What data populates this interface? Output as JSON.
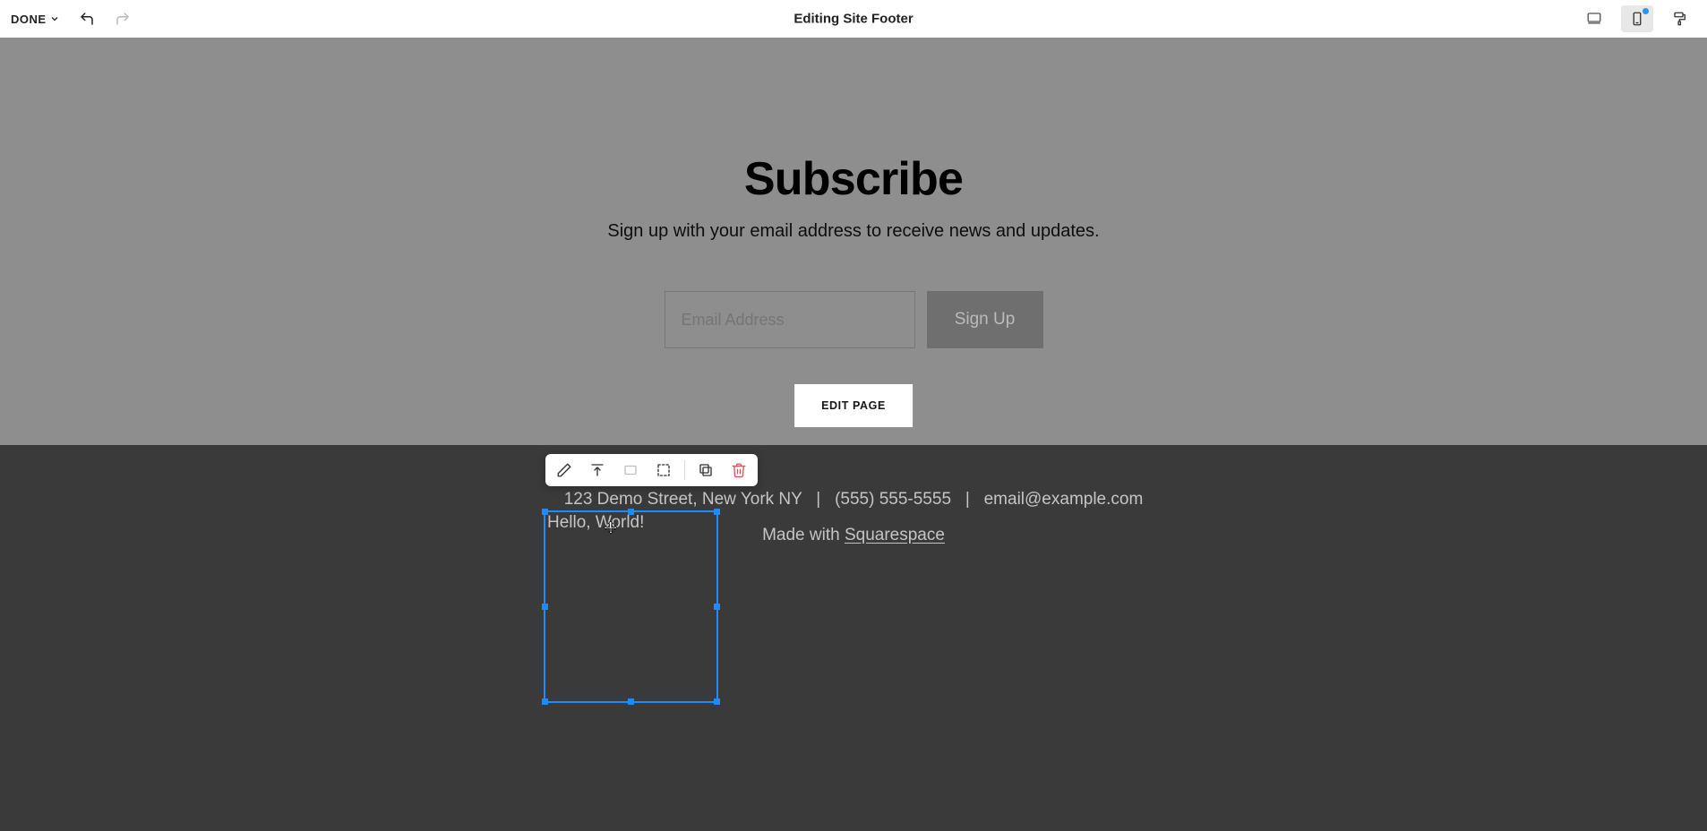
{
  "topbar": {
    "done_label": "DONE",
    "title": "Editing Site Footer"
  },
  "subscribe": {
    "heading": "Subscribe",
    "subheading": "Sign up with your email address to receive news and updates.",
    "email_placeholder": "Email Address",
    "signup_label": "Sign Up",
    "edit_page_label": "EDIT PAGE"
  },
  "footer": {
    "contact_line": "123 Demo Street, New York NY   |   (555) 555-5555   |   email@example.com",
    "made_with_prefix": "Made with ",
    "made_with_link": "Squarespace"
  },
  "selected_block": {
    "text": "Hello, World!"
  },
  "colors": {
    "selection": "#1a8cff",
    "footer_bg": "#3a3a3a",
    "section_bg": "#8e8e8e"
  }
}
